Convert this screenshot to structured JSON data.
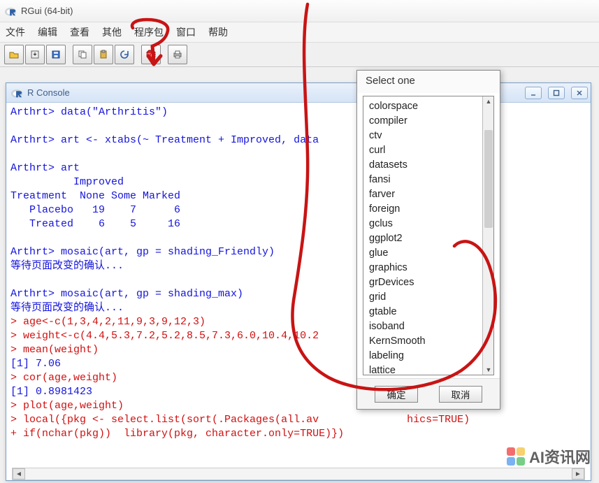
{
  "window": {
    "title": "RGui (64-bit)"
  },
  "menu": {
    "items": [
      "文件",
      "编辑",
      "查看",
      "其他",
      "程序包",
      "窗口",
      "帮助"
    ]
  },
  "toolbar_icons": [
    "open-icon",
    "load-icon",
    "save-icon",
    "copy-icon",
    "paste-icon",
    "refresh-icon",
    "stop-icon",
    "print-icon"
  ],
  "console": {
    "title": "R Console",
    "lines": [
      {
        "cls": "blue",
        "t": "Arthrt> data(\"Arthritis\")"
      },
      {
        "cls": "",
        "t": ""
      },
      {
        "cls": "blue",
        "t": "Arthrt> art <- xtabs(~ Treatment + Improved, data              = Sex == $"
      },
      {
        "cls": "",
        "t": ""
      },
      {
        "cls": "blue",
        "t": "Arthrt> art"
      },
      {
        "cls": "blue",
        "t": "          Improved"
      },
      {
        "cls": "blue",
        "t": "Treatment  None Some Marked"
      },
      {
        "cls": "blue",
        "t": "   Placebo   19    7      6"
      },
      {
        "cls": "blue",
        "t": "   Treated    6    5     16"
      },
      {
        "cls": "",
        "t": ""
      },
      {
        "cls": "blue",
        "t": "Arthrt> mosaic(art, gp = shading_Friendly)"
      },
      {
        "cls": "blue",
        "t": "等待页面改变的确认..."
      },
      {
        "cls": "",
        "t": ""
      },
      {
        "cls": "blue",
        "t": "Arthrt> mosaic(art, gp = shading_max)"
      },
      {
        "cls": "blue",
        "t": "等待页面改变的确认..."
      },
      {
        "cls": "red",
        "t": "> age<-c(1,3,4,2,11,9,3,9,12,3)"
      },
      {
        "cls": "red",
        "t": "> weight<-c(4.4,5.3,7.2,5.2,8.5,7.3,6.0,10.4,10.2"
      },
      {
        "cls": "red",
        "t": "> mean(weight)"
      },
      {
        "cls": "blue",
        "t": "[1] 7.06"
      },
      {
        "cls": "red",
        "t": "> cor(age,weight)"
      },
      {
        "cls": "blue",
        "t": "[1] 0.8981423"
      },
      {
        "cls": "red",
        "t": "> plot(age,weight)"
      },
      {
        "cls": "red",
        "t": "> local({pkg <- select.list(sort(.Packages(all.av              hics=TRUE)"
      },
      {
        "cls": "red",
        "t": "+ if(nchar(pkg))  library(pkg, character.only=TRUE)})"
      }
    ]
  },
  "popup": {
    "title": "Select one",
    "items": [
      "colorspace",
      "compiler",
      "ctv",
      "curl",
      "datasets",
      "fansi",
      "farver",
      "foreign",
      "gclus",
      "ggplot2",
      "glue",
      "graphics",
      "grDevices",
      "grid",
      "gtable",
      "isoband",
      "KernSmooth",
      "labeling",
      "lattice"
    ],
    "ok": "确定",
    "cancel": "取消"
  },
  "watermark": {
    "text": "AI资讯网"
  }
}
